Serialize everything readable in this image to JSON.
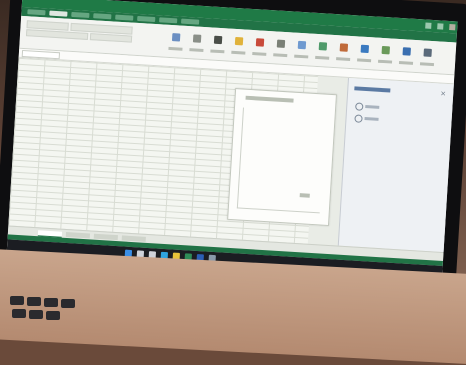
{
  "window": {
    "title": "",
    "controls": [
      "minimize",
      "maximize",
      "close"
    ]
  },
  "ribbon": {
    "tabs": [
      "",
      "",
      "",
      "",
      "",
      "",
      "",
      ""
    ],
    "buttons": [
      {
        "icon": "paste-icon",
        "color": "#6b8fc2"
      },
      {
        "icon": "cut-icon",
        "color": "#8a8f88"
      },
      {
        "icon": "bold-icon",
        "color": "#4a4e48"
      },
      {
        "icon": "fill-color-icon",
        "color": "#e0b23a"
      },
      {
        "icon": "font-color-icon",
        "color": "#c84a3a"
      },
      {
        "icon": "align-icon",
        "color": "#7a8076"
      },
      {
        "icon": "merge-icon",
        "color": "#6f9ad0"
      },
      {
        "icon": "number-format-icon",
        "color": "#4f9a6a"
      },
      {
        "icon": "conditional-format-icon",
        "color": "#c06b3a"
      },
      {
        "icon": "table-format-icon",
        "color": "#3a7ac0"
      },
      {
        "icon": "insert-icon",
        "color": "#6a9a5a"
      },
      {
        "icon": "sort-filter-icon",
        "color": "#3a6fb0"
      },
      {
        "icon": "find-icon",
        "color": "#5a6a7a"
      }
    ]
  },
  "formula_bar": {
    "name_box": "",
    "fx_label": "",
    "value": ""
  },
  "chart_object": {
    "title": "",
    "legend": ""
  },
  "task_pane": {
    "title": "",
    "options": [
      "",
      ""
    ]
  },
  "sheet_tabs": [
    "",
    "",
    "",
    ""
  ],
  "taskbar": {
    "apps": [
      {
        "icon": "start-icon",
        "color": "#3a8ee6"
      },
      {
        "icon": "search-icon",
        "color": "#cfd3da"
      },
      {
        "icon": "task-view-icon",
        "color": "#cfd3da"
      },
      {
        "icon": "edge-icon",
        "color": "#2fa4e0"
      },
      {
        "icon": "file-explorer-icon",
        "color": "#e8c23a"
      },
      {
        "icon": "excel-icon",
        "color": "#2e8b57"
      },
      {
        "icon": "word-icon",
        "color": "#2b5fb5"
      },
      {
        "icon": "store-icon",
        "color": "#8a9aaa"
      }
    ],
    "clock": ""
  },
  "colors": {
    "accent": "#217346",
    "titlebar": "#1f7a46"
  }
}
